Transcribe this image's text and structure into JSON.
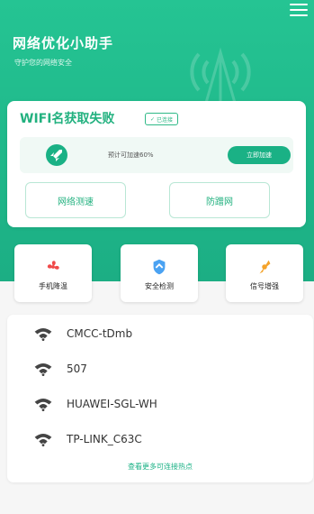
{
  "header": {
    "title": "网络优化小助手",
    "subtitle": "守护您的网络安全",
    "menu_icon": "hamburger-menu-icon"
  },
  "status_card": {
    "title": "WIFI名获取失败",
    "tag": "已连接",
    "boost_text": "预计可加速60%",
    "boost_button": "立即加速",
    "actions": [
      "网络测速",
      "防蹭网"
    ]
  },
  "features": [
    {
      "label": "手机降温",
      "icon": "fan-icon"
    },
    {
      "label": "安全检测",
      "icon": "shield-icon"
    },
    {
      "label": "信号增强",
      "icon": "signal-icon"
    }
  ],
  "wifi_list": {
    "networks": [
      "CMCC-tDmb",
      "507",
      "HUAWEI-SGL-WH",
      "TP-LINK_C63C"
    ],
    "more_link": "查看更多可连接热点"
  },
  "colors": {
    "brand": "#1eb588",
    "accent": "#22b17f"
  }
}
